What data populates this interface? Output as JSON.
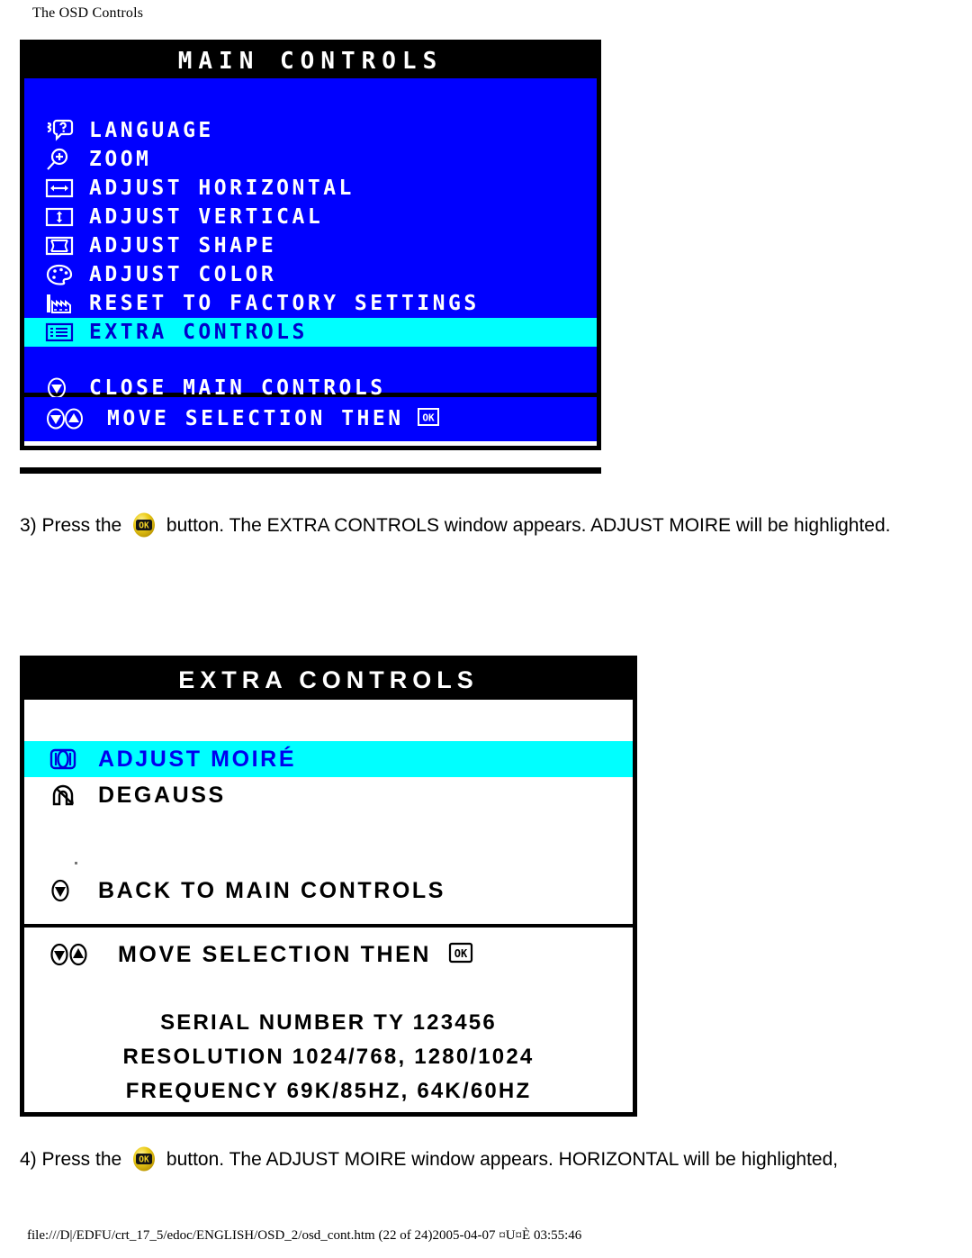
{
  "page": {
    "title": "The OSD Controls",
    "footer": "file:///D|/EDFU/crt_17_5/edoc/ENGLISH/OSD_2/osd_cont.htm (22 of 24)2005-04-07 ¤U¤È 03:55:46"
  },
  "colors": {
    "osd_blue": "#0000FF",
    "highlight_cyan": "#00FFFF",
    "border_black": "#000000",
    "text_white": "#FFFFFF",
    "button_yellow": "#E8C000"
  },
  "main_window": {
    "title": "MAIN CONTROLS",
    "items": [
      {
        "label": "LANGUAGE",
        "icon": "language-speech-bubble-icon",
        "selected": false
      },
      {
        "label": "ZOOM",
        "icon": "magnifier-plus-icon",
        "selected": false
      },
      {
        "label": "ADJUST HORIZONTAL",
        "icon": "horizontal-arrows-icon",
        "selected": false
      },
      {
        "label": "ADJUST VERTICAL",
        "icon": "vertical-arrows-icon",
        "selected": false
      },
      {
        "label": "ADJUST SHAPE",
        "icon": "shape-pincushion-icon",
        "selected": false
      },
      {
        "label": "ADJUST COLOR",
        "icon": "color-palette-icon",
        "selected": false
      },
      {
        "label": "RESET TO FACTORY SETTINGS",
        "icon": "factory-reset-icon",
        "selected": false
      },
      {
        "label": "EXTRA CONTROLS",
        "icon": "list-lines-icon",
        "selected": true
      }
    ],
    "close_item": {
      "label": "CLOSE MAIN CONTROLS",
      "icon": "down-arrow-circle-icon"
    },
    "hint": {
      "label": "MOVE SELECTION THEN",
      "icons": [
        "down-arrow-circle-icon",
        "up-arrow-circle-icon"
      ],
      "trailing_icon": "ok-button-icon"
    }
  },
  "step3": {
    "prefix": "3) Press the",
    "button_icon": "ok-button-icon",
    "suffix": "button. The EXTRA CONTROLS window appears. ADJUST MOIRE will be highlighted."
  },
  "extra_window": {
    "title": "EXTRA CONTROLS",
    "items": [
      {
        "label": "ADJUST MOIRÉ",
        "icon": "moire-pattern-icon",
        "selected": true
      },
      {
        "label": "DEGAUSS",
        "icon": "degauss-magnet-icon",
        "selected": false
      }
    ],
    "back_item": {
      "label": "BACK TO MAIN CONTROLS",
      "icon": "down-arrow-circle-icon"
    },
    "hint": {
      "label": "MOVE SELECTION THEN",
      "icons": [
        "down-arrow-circle-icon",
        "up-arrow-circle-icon"
      ],
      "trailing_icon": "ok-button-icon"
    },
    "info_lines": [
      "SERIAL NUMBER TY 123456",
      "RESOLUTION 1024/768, 1280/1024",
      "FREQUENCY 69K/85HZ, 64K/60HZ"
    ]
  },
  "step4": {
    "prefix": "4) Press the",
    "button_icon": "ok-button-icon",
    "suffix": "button. The ADJUST MOIRE window appears. HORIZONTAL will be highlighted,"
  }
}
